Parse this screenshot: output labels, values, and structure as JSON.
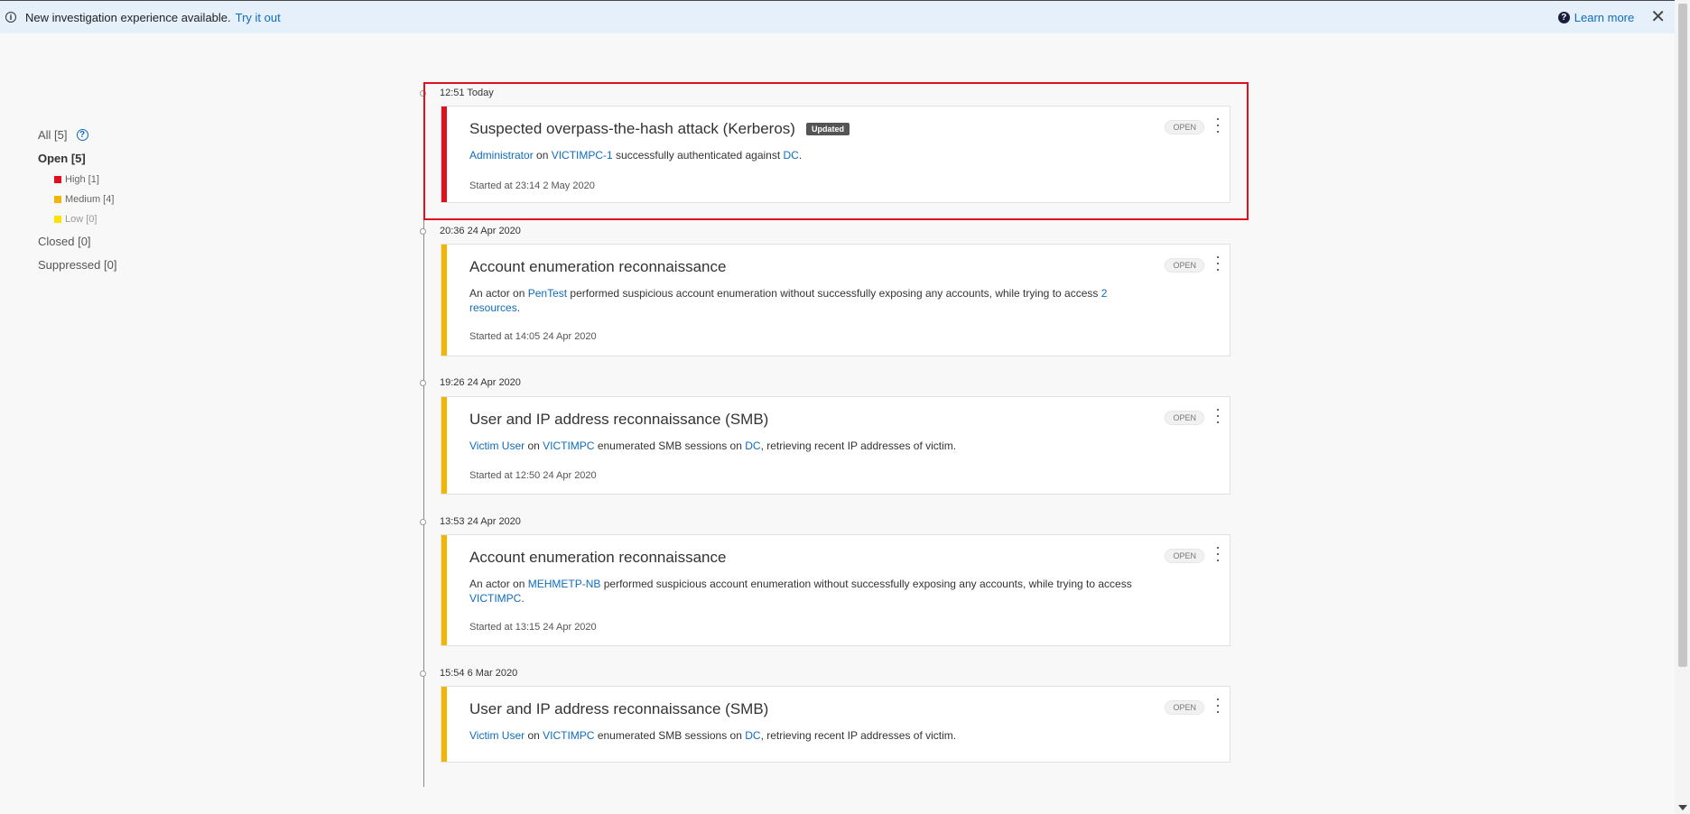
{
  "banner": {
    "message": "New investigation experience available.",
    "try_link": "Try it out",
    "learn_more": "Learn more"
  },
  "filters": {
    "all": "All [5]",
    "open": "Open [5]",
    "high": "High [1]",
    "medium": "Medium [4]",
    "low": "Low [0]",
    "closed": "Closed [0]",
    "suppressed": "Suppressed [0]"
  },
  "colors": {
    "high": "#e0101e",
    "medium": "#f4b400",
    "low": "#ffe100",
    "link": "#0f6cbd"
  },
  "alerts": [
    {
      "time": "12:51 Today",
      "title": "Suspected overpass-the-hash attack (Kerberos)",
      "badge": "Updated",
      "status": "OPEN",
      "severity": "high",
      "desc": [
        {
          "link": "Administrator"
        },
        {
          "text": " on "
        },
        {
          "link": "VICTIMPC-1"
        },
        {
          "text": " successfully authenticated against "
        },
        {
          "link": "DC"
        },
        {
          "text": "."
        }
      ],
      "started": "Started at 23:14 2 May 2020"
    },
    {
      "time": "20:36 24 Apr 2020",
      "title": "Account enumeration reconnaissance",
      "status": "OPEN",
      "severity": "medium",
      "desc": [
        {
          "text": "An actor on "
        },
        {
          "link": "PenTest"
        },
        {
          "text": " performed suspicious account enumeration without successfully exposing any accounts, while trying to access "
        },
        {
          "link": "2 resources"
        },
        {
          "text": "."
        }
      ],
      "started": "Started at 14:05 24 Apr 2020"
    },
    {
      "time": "19:26 24 Apr 2020",
      "title": "User and IP address reconnaissance (SMB)",
      "status": "OPEN",
      "severity": "medium",
      "desc": [
        {
          "link": "Victim User"
        },
        {
          "text": " on "
        },
        {
          "link": "VICTIMPC"
        },
        {
          "text": " enumerated SMB sessions on "
        },
        {
          "link": "DC"
        },
        {
          "text": ", retrieving recent IP addresses of victim."
        }
      ],
      "started": "Started at 12:50 24 Apr 2020"
    },
    {
      "time": "13:53 24 Apr 2020",
      "title": "Account enumeration reconnaissance",
      "status": "OPEN",
      "severity": "medium",
      "desc": [
        {
          "text": "An actor on "
        },
        {
          "link": "MEHMETP-NB"
        },
        {
          "text": " performed suspicious account enumeration without successfully exposing any accounts, while trying to access "
        },
        {
          "link": "VICTIMPC"
        },
        {
          "text": "."
        }
      ],
      "started": "Started at 13:15 24 Apr 2020"
    },
    {
      "time": "15:54 6 Mar 2020",
      "title": "User and IP address reconnaissance (SMB)",
      "status": "OPEN",
      "severity": "medium",
      "desc": [
        {
          "link": "Victim User"
        },
        {
          "text": " on "
        },
        {
          "link": "VICTIMPC"
        },
        {
          "text": " enumerated SMB sessions on "
        },
        {
          "link": "DC"
        },
        {
          "text": ", retrieving recent IP addresses of victim."
        }
      ],
      "started": ""
    }
  ]
}
